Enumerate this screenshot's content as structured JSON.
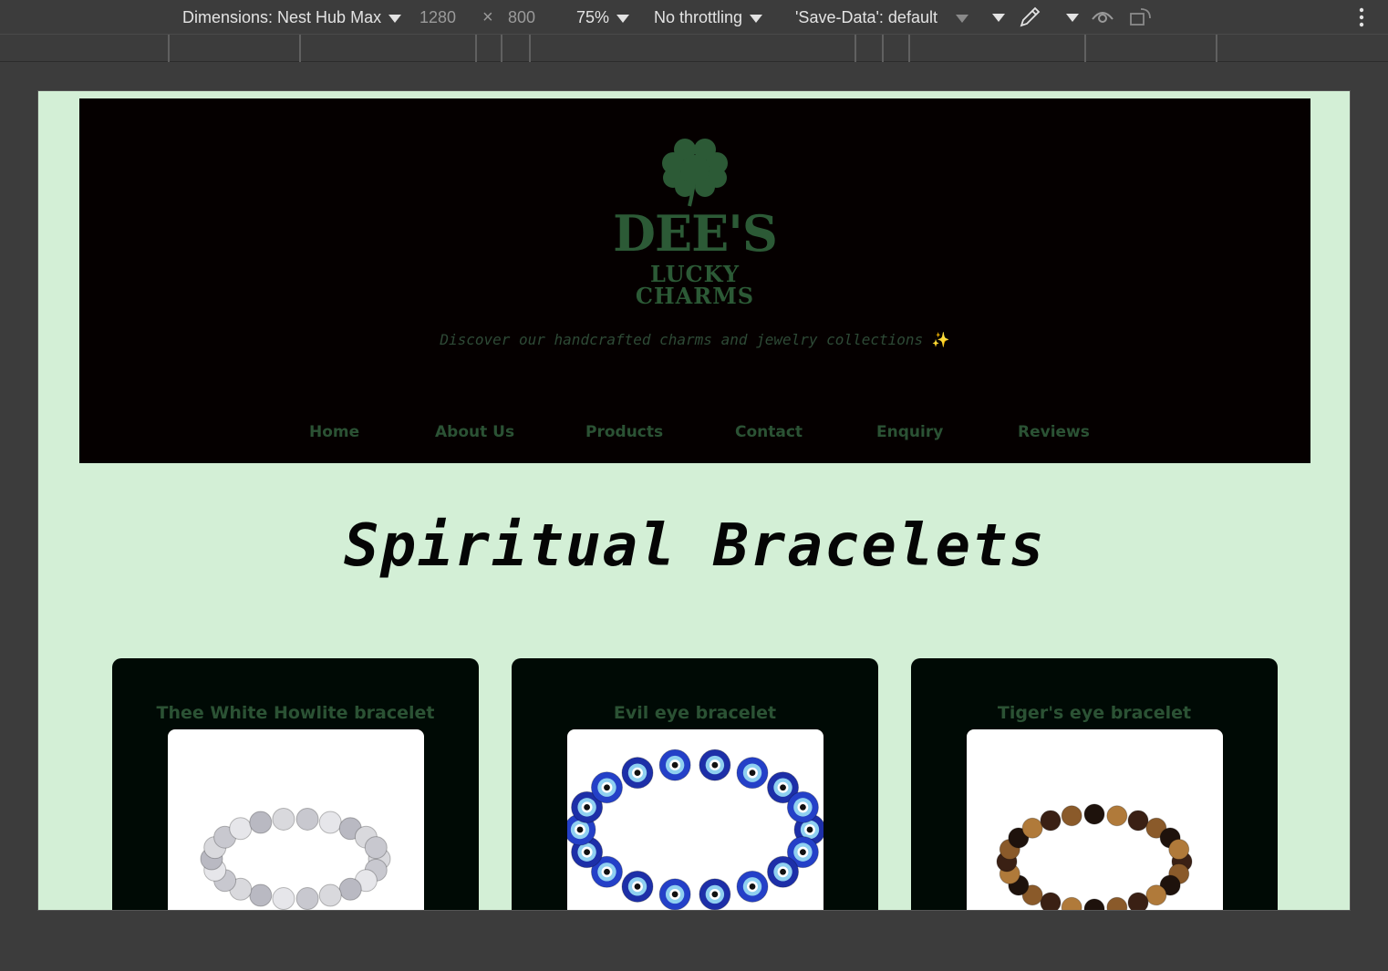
{
  "devtools": {
    "dimensions_label": "Dimensions: Nest Hub Max",
    "width": "1280",
    "times": "×",
    "height": "800",
    "zoom": "75%",
    "throttling": "No throttling",
    "save_data": "'Save-Data': default",
    "icons": [
      "eyedropper-icon",
      "eye-icon",
      "rotate-icon",
      "more-vert-icon"
    ]
  },
  "site": {
    "logo": {
      "line1": "DEE'S",
      "line2": "LUCKY",
      "line3": "CHARMS"
    },
    "tagline": "Discover our handcrafted charms and jewelry collections",
    "tagline_emoji": "✨",
    "nav": [
      "Home",
      "About Us",
      "Products",
      "Contact",
      "Enquiry",
      "Reviews"
    ],
    "page_title": "Spiritual Bracelets",
    "products": [
      {
        "title": "Thee White Howlite bracelet"
      },
      {
        "title": "Evil eye bracelet"
      },
      {
        "title": "Tiger's eye bracelet"
      }
    ],
    "colors": {
      "page_bg": "#d3efd6",
      "header_bg": "#050000",
      "accent_green": "#2b5234",
      "card_bg": "#000a05"
    }
  }
}
